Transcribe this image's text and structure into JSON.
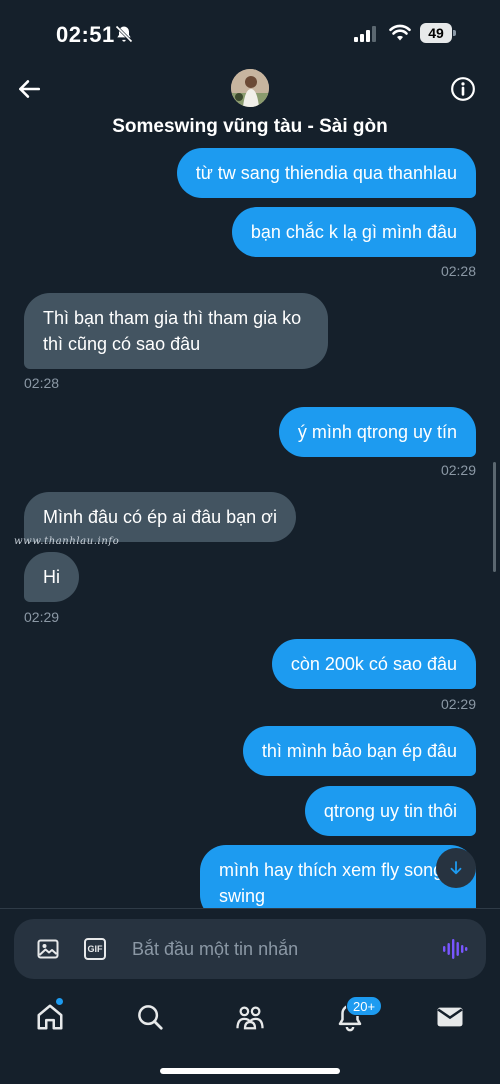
{
  "status_bar": {
    "time": "02:51",
    "battery": "49"
  },
  "header": {
    "title": "Someswing vũng tàu - Sài gòn"
  },
  "watermark": "www.thanhlau.info",
  "messages": [
    {
      "direction": "out",
      "text": "từ tw sang thiendia qua thanhlau"
    },
    {
      "direction": "out",
      "text": "bạn chắc k lạ gì mình đâu"
    },
    {
      "timestamp": "02:28"
    },
    {
      "direction": "in",
      "text": "Thì bạn tham gia thì tham gia ko thì cũng có sao đâu"
    },
    {
      "timestamp": "02:28"
    },
    {
      "direction": "out",
      "text": "ý mình qtrong uy tín"
    },
    {
      "timestamp": "02:29"
    },
    {
      "direction": "in",
      "text": "Mình đâu có ép ai đâu bạn ơi"
    },
    {
      "direction": "in",
      "text": "Hi"
    },
    {
      "timestamp": "02:29"
    },
    {
      "direction": "out",
      "text": "còn 200k có sao đâu"
    },
    {
      "timestamp": "02:29"
    },
    {
      "direction": "out",
      "text": "thì mình bảo bạn ép đâu"
    },
    {
      "direction": "out",
      "text": "qtrong uy tin thôi"
    },
    {
      "direction": "out",
      "text": "mình hay thích xem fly song swing"
    }
  ],
  "composer": {
    "placeholder": "Bắt đầu một tin nhắn",
    "gif_label": "GIF"
  },
  "tabbar": {
    "notifications_badge": "20+"
  },
  "colors": {
    "background": "#15202b",
    "outgoing": "#1d9bf0",
    "incoming": "#435461",
    "muted": "#8b98a5",
    "accent_voice": "#7856ff"
  }
}
